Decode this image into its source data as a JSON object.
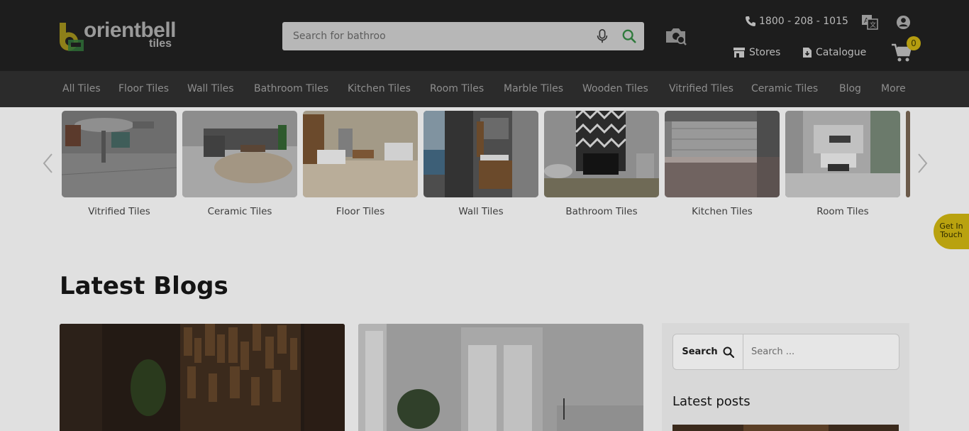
{
  "header": {
    "logo_text": "orientbell",
    "logo_sub": "tiles",
    "search_placeholder": "Search for bathroo",
    "phone": "1800 - 208 - 1015",
    "stores": "Stores",
    "catalogue": "Catalogue",
    "cart_count": "0"
  },
  "nav": [
    "All Tiles",
    "Floor Tiles",
    "Wall Tiles",
    "Bathroom Tiles",
    "Kitchen Tiles",
    "Room Tiles",
    "Marble Tiles",
    "Wooden Tiles",
    "Vitrified Tiles",
    "Ceramic Tiles",
    "Blog",
    "More"
  ],
  "categories": [
    "Vitrified Tiles",
    "Ceramic Tiles",
    "Floor Tiles",
    "Wall Tiles",
    "Bathroom Tiles",
    "Kitchen Tiles",
    "Room Tiles"
  ],
  "get_in_touch": {
    "line1": "Get In",
    "line2": "Touch"
  },
  "blogs": {
    "title": "Latest Blogs"
  },
  "sidebar": {
    "search_button": "Search",
    "search_placeholder": "Search ...",
    "latest_posts": "Latest posts"
  },
  "colors": {
    "header_bg": "#1d1d1d",
    "nav_bg": "#2b2b2b",
    "accent_yellow": "#b9a20f",
    "search_green": "#2f7a3c"
  }
}
